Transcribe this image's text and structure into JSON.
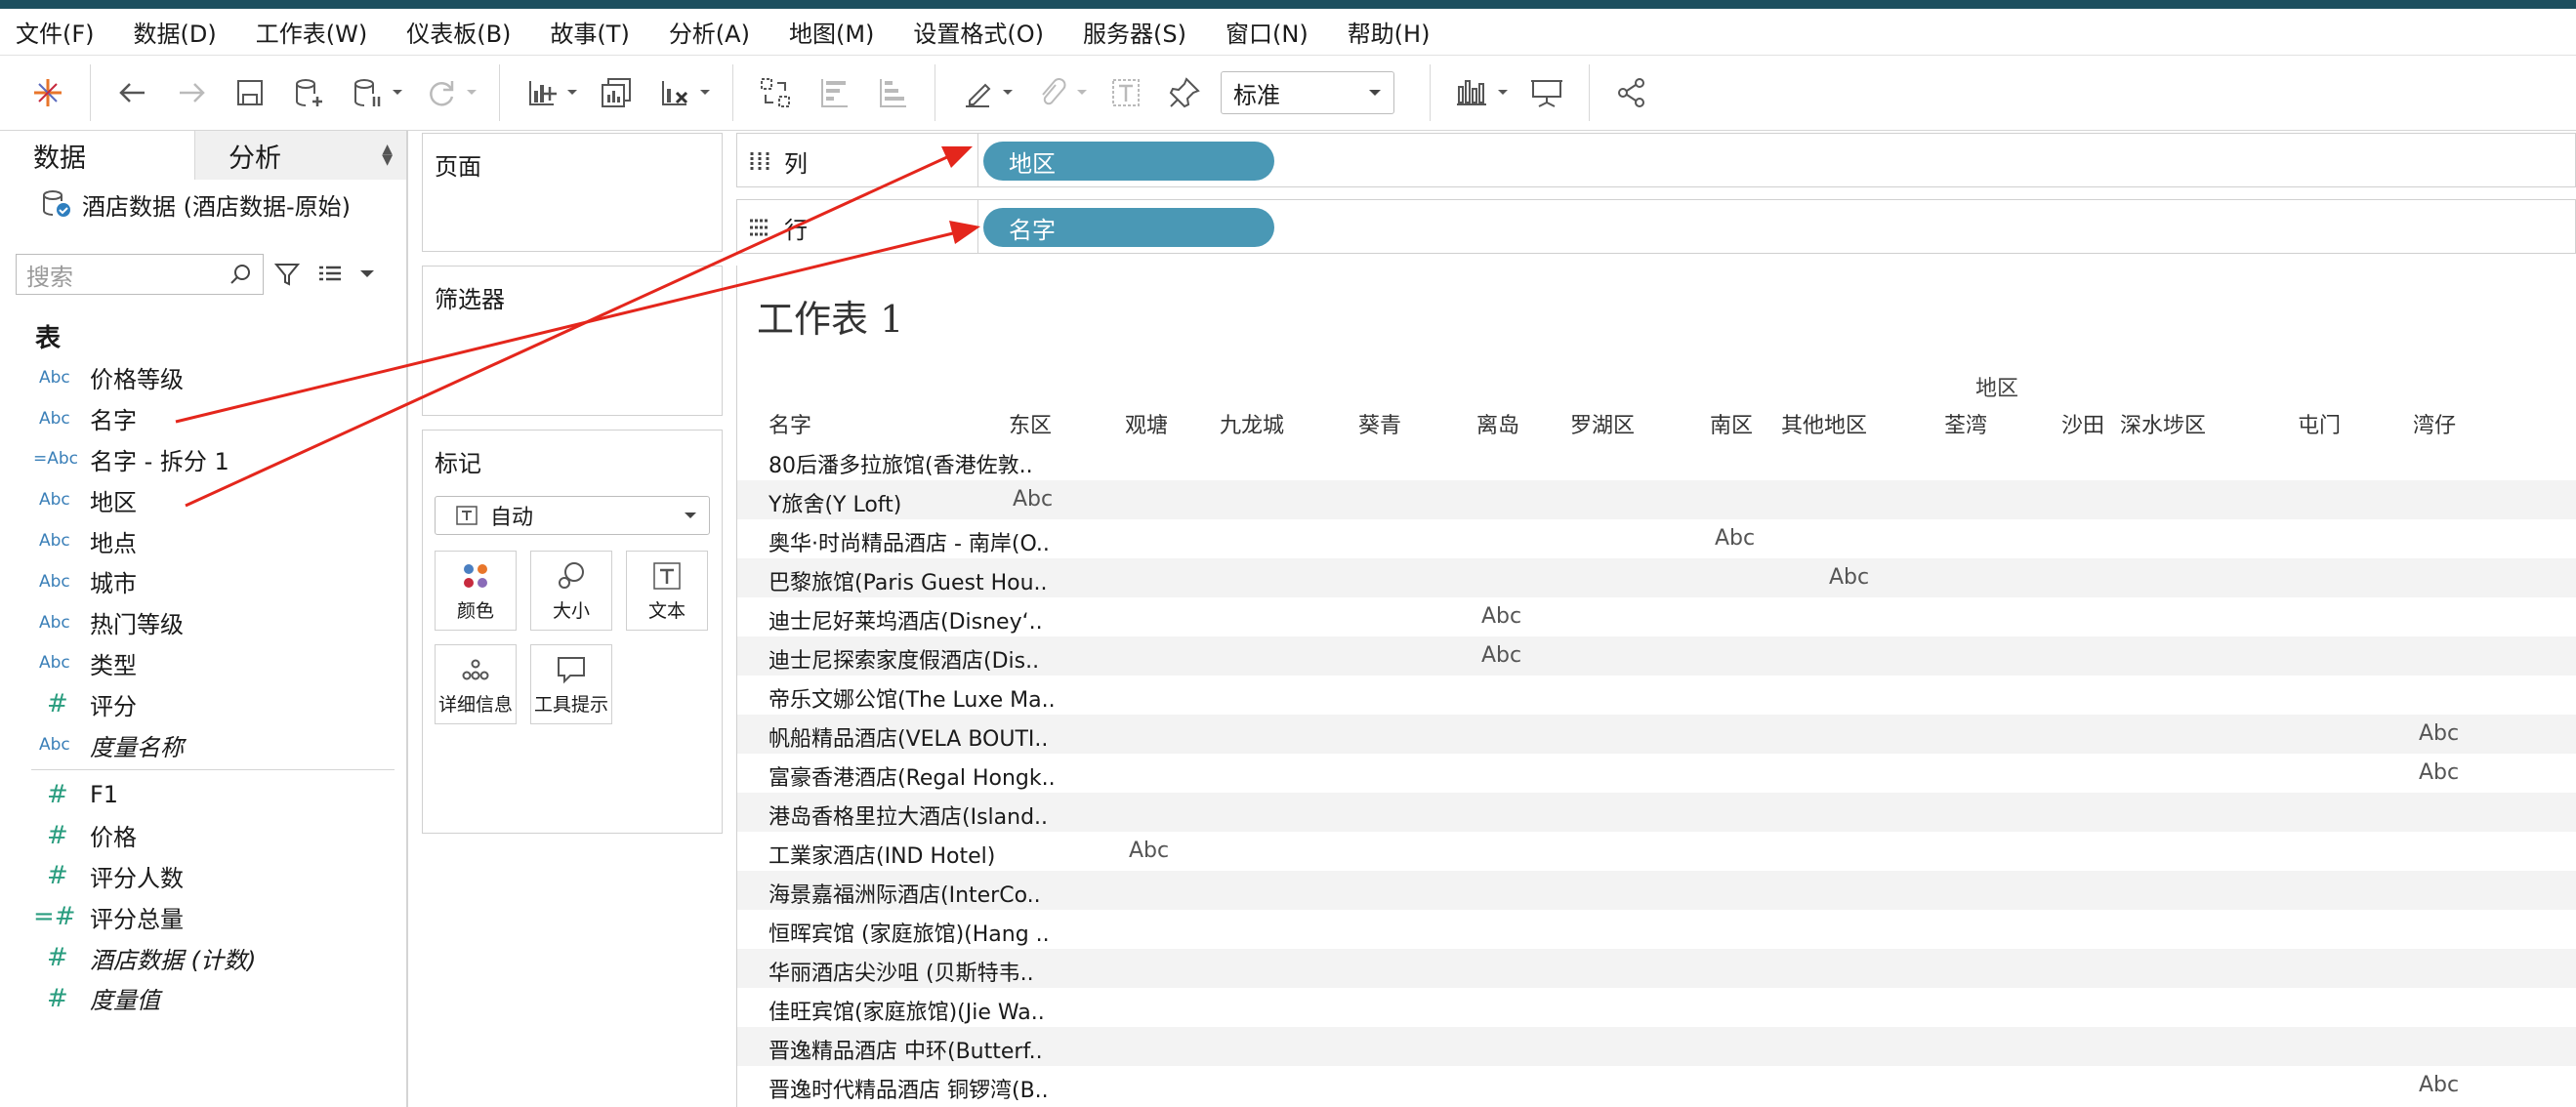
{
  "menu": [
    "文件(F)",
    "数据(D)",
    "工作表(W)",
    "仪表板(B)",
    "故事(T)",
    "分析(A)",
    "地图(M)",
    "设置格式(O)",
    "服务器(S)",
    "窗口(N)",
    "帮助(H)"
  ],
  "toolbar": {
    "fit_select": "标准"
  },
  "data_pane": {
    "tabs": {
      "data": "数据",
      "analysis": "分析"
    },
    "datasource": "酒店数据 (酒店数据-原始)",
    "search_placeholder": "搜索",
    "table_heading": "表",
    "fields": [
      {
        "type": "Abc",
        "name": "价格等级"
      },
      {
        "type": "Abc",
        "name": "名字"
      },
      {
        "type": "=Abc",
        "name": "名字 - 拆分 1"
      },
      {
        "type": "Abc",
        "name": "地区"
      },
      {
        "type": "Abc",
        "name": "地点"
      },
      {
        "type": "Abc",
        "name": "城市"
      },
      {
        "type": "Abc",
        "name": "热门等级"
      },
      {
        "type": "Abc",
        "name": "类型"
      },
      {
        "type": "#",
        "name": "评分"
      },
      {
        "type": "Abc",
        "name": "度量名称"
      }
    ],
    "measures": [
      {
        "type": "#",
        "name": "F1"
      },
      {
        "type": "#",
        "name": "价格"
      },
      {
        "type": "#",
        "name": "评分人数"
      },
      {
        "type": "=#",
        "name": "评分总量"
      },
      {
        "type": "#",
        "name": "酒店数据 (计数)"
      },
      {
        "type": "#",
        "name": "度量值"
      }
    ]
  },
  "shelves": {
    "pages": "页面",
    "filters": "筛选器",
    "marks": "标记",
    "marks_type": "自动",
    "mark_buttons": [
      "颜色",
      "大小",
      "文本",
      "详细信息",
      "工具提示"
    ]
  },
  "columns_shelf": {
    "label": "列",
    "pill": "地区"
  },
  "rows_shelf": {
    "label": "行",
    "pill": "名字"
  },
  "worksheet": {
    "title": "工作表 1",
    "column_group": "地区",
    "row_header": "名字",
    "regions": [
      "东区",
      "观塘",
      "九龙城",
      "葵青",
      "离岛",
      "罗湖区",
      "南区",
      "其他地区",
      "荃湾",
      "沙田",
      "深水埗区",
      "屯门",
      "湾仔"
    ],
    "cell_text": "Abc",
    "rows": [
      {
        "name": "80后潘多拉旅馆(香港佐敦..",
        "region": -1
      },
      {
        "name": "Y旅舍(Y Loft)",
        "region": 0
      },
      {
        "name": "奥华·时尚精品酒店 - 南岸(O..",
        "region": 6
      },
      {
        "name": "巴黎旅馆(Paris Guest Hou..",
        "region": 7
      },
      {
        "name": "迪士尼好莱坞酒店(Disney‘..",
        "region": 4
      },
      {
        "name": "迪士尼探索家度假酒店(Dis..",
        "region": 4
      },
      {
        "name": "帝乐文娜公馆(The Luxe Ma..",
        "region": -1
      },
      {
        "name": "帆船精品酒店(VELA BOUTI..",
        "region": 12
      },
      {
        "name": "富豪香港酒店(Regal Hongk..",
        "region": 12
      },
      {
        "name": "港岛香格里拉大酒店(Island..",
        "region": -1
      },
      {
        "name": "工業家酒店(IND Hotel)",
        "region": 1
      },
      {
        "name": "海景嘉福洲际酒店(InterCo..",
        "region": -1
      },
      {
        "name": "恒晖宾馆 (家庭旅馆)(Hang ..",
        "region": -1
      },
      {
        "name": "华丽酒店尖沙咀 (贝斯特韦..",
        "region": -1
      },
      {
        "name": "佳旺宾馆(家庭旅馆)(Jie Wa..",
        "region": -1
      },
      {
        "name": "晋逸精品酒店 中环(Butterf..",
        "region": -1
      },
      {
        "name": "晋逸时代精品酒店 铜锣湾(B..",
        "region": 12
      }
    ]
  }
}
